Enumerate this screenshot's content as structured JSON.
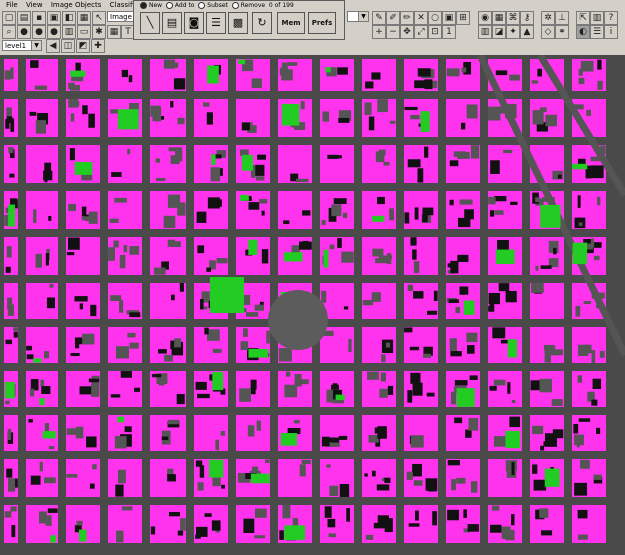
{
  "menu": {
    "items": [
      "File",
      "View",
      "Image Objects",
      "Classification"
    ]
  },
  "toolbar": {
    "object_dropdown_value": "Image obj",
    "level_dropdown_value": "level1"
  },
  "toolbox": {
    "mode_new": "New",
    "mode_add_to": "Add to",
    "mode_subset": "Subset",
    "mode_remove": "Remove",
    "counter": "0 of 199",
    "selected_mode": "New",
    "mem_label": "Mem",
    "prefs_label": "Prefs"
  },
  "colors": {
    "building_class": "#ff33ee",
    "vegetation_class": "#22cc22",
    "road": "#555555",
    "toolbar_bg": "#d4d0c8"
  },
  "icons": [
    "line-tool-icon",
    "window-icon",
    "drum-icon",
    "stack-icon",
    "brick-icon",
    "refresh-icon"
  ]
}
